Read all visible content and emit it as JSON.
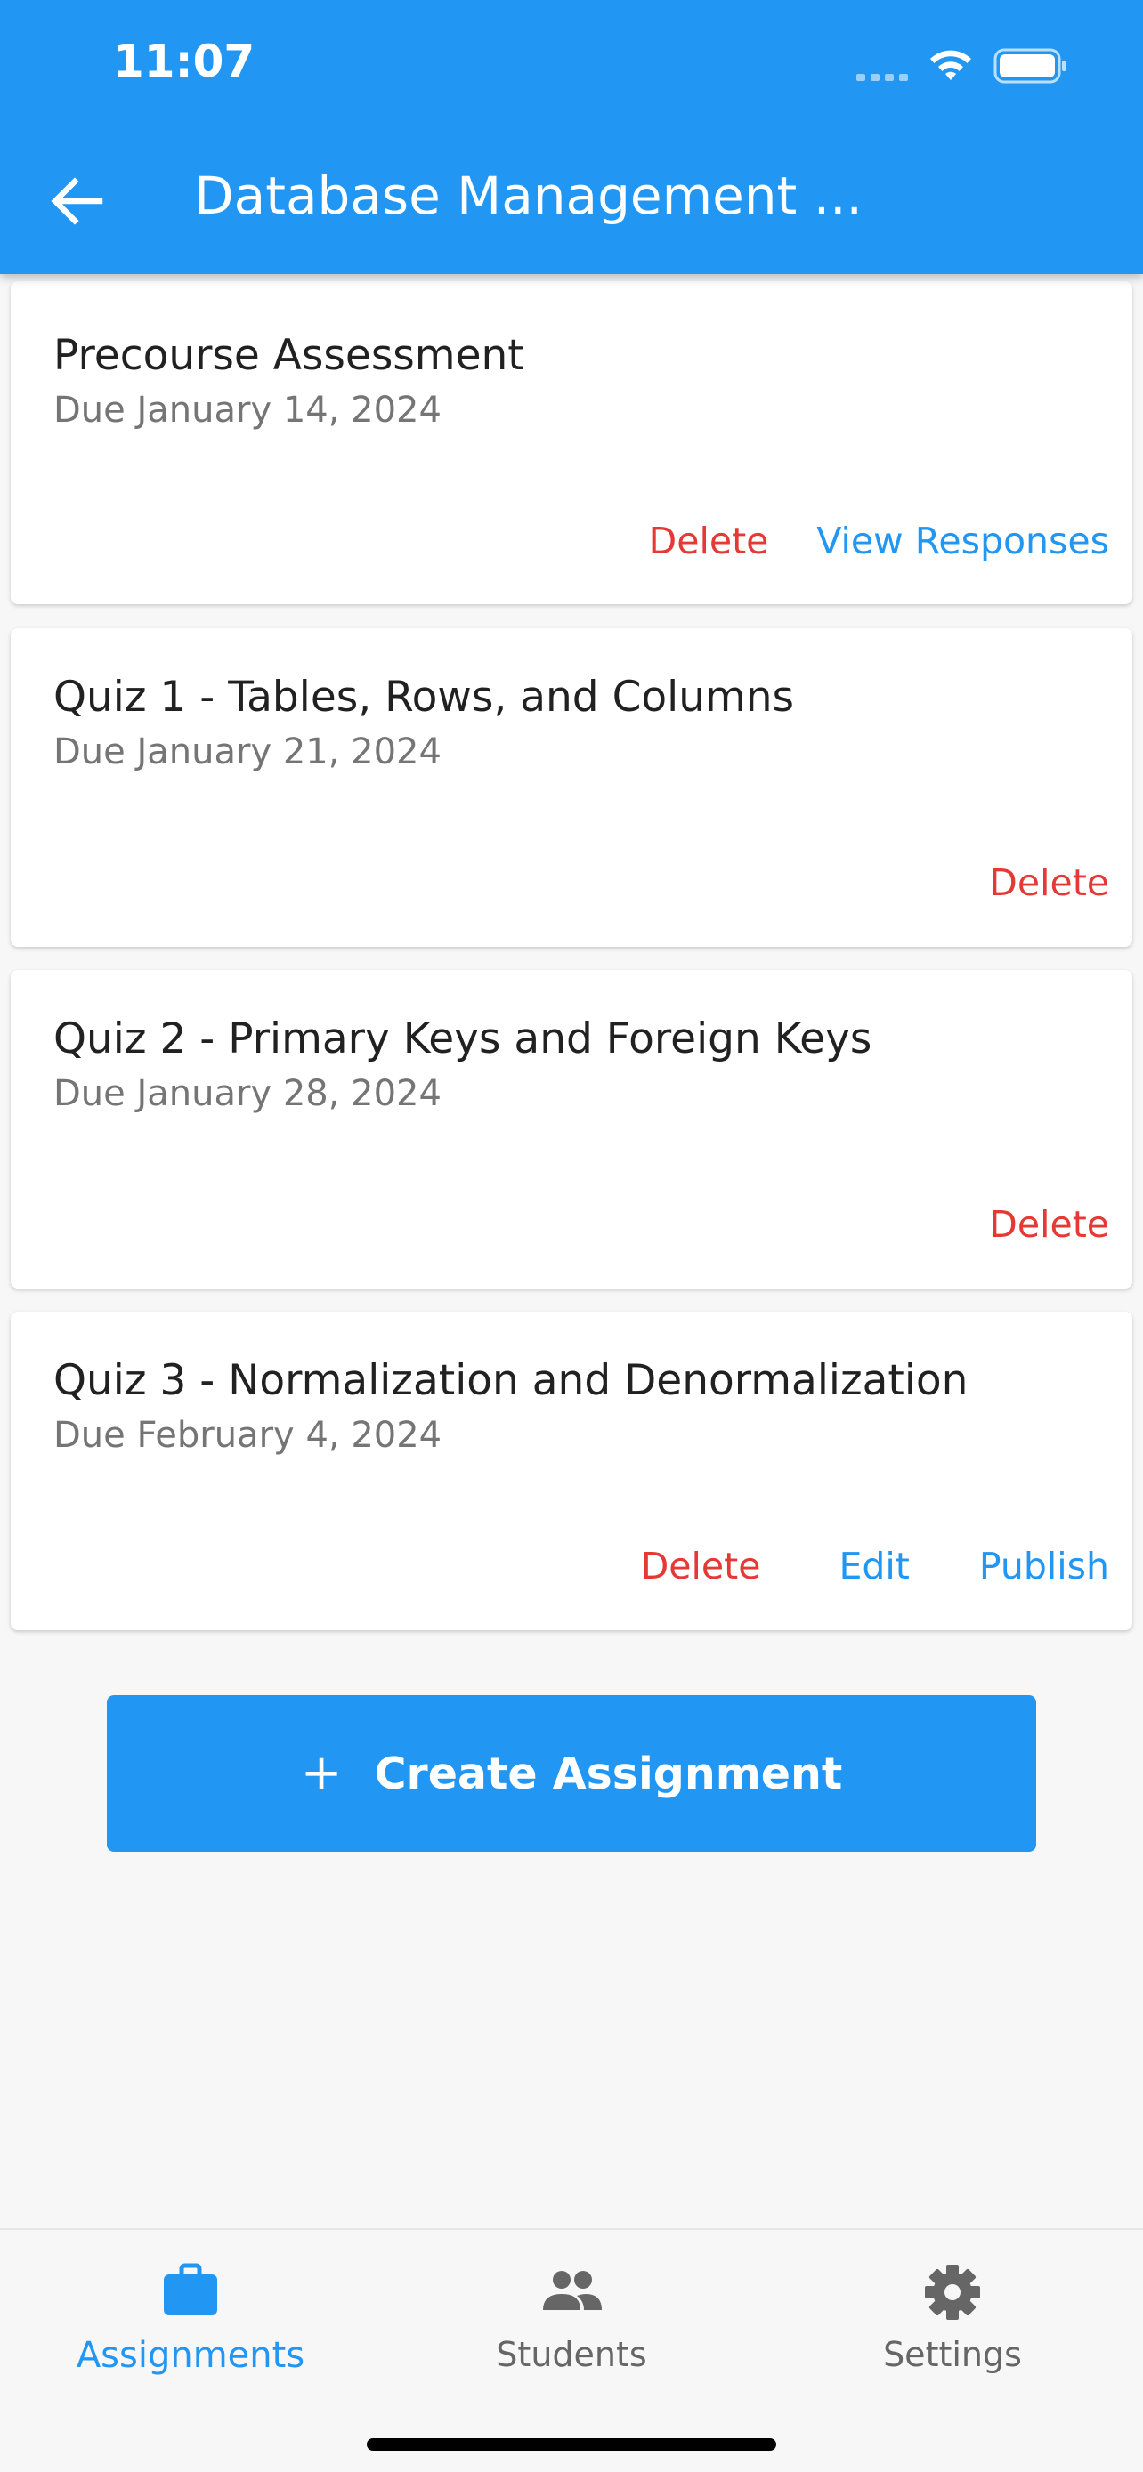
{
  "status_bar": {
    "time": "11:07"
  },
  "header": {
    "title": "Database Management ..."
  },
  "assignments": [
    {
      "title": "Precourse Assessment",
      "due": "Due January 14, 2024",
      "actions": [
        "Delete",
        "View Responses"
      ]
    },
    {
      "title": "Quiz 1 - Tables, Rows, and Columns",
      "due": "Due January 21, 2024",
      "actions": [
        "Delete"
      ]
    },
    {
      "title": "Quiz 2 - Primary Keys and Foreign Keys",
      "due": "Due January 28, 2024",
      "actions": [
        "Delete"
      ]
    },
    {
      "title": "Quiz 3 - Normalization and Denormalization",
      "due": "Due February 4, 2024",
      "actions": [
        "Delete",
        "Edit",
        "Publish"
      ]
    }
  ],
  "create_button": {
    "icon": "+",
    "label": "Create Assignment"
  },
  "bottom_nav": [
    {
      "label": "Assignments",
      "icon": "briefcase-icon",
      "active": true
    },
    {
      "label": "Students",
      "icon": "people-icon",
      "active": false
    },
    {
      "label": "Settings",
      "icon": "gear-icon",
      "active": false
    }
  ],
  "colors": {
    "primary": "#2196f3",
    "danger": "#e53935",
    "background": "#f7f7f7",
    "inactive": "#666666"
  }
}
